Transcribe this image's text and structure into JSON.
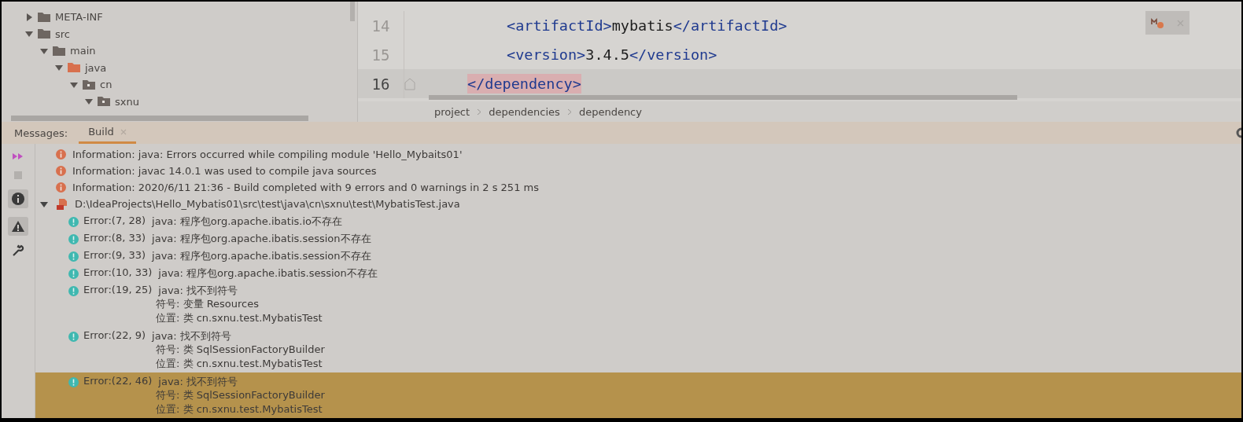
{
  "project_tree": {
    "items": [
      {
        "label": "META-INF",
        "expanded": false,
        "kind": "plain"
      },
      {
        "label": "src",
        "expanded": true,
        "kind": "plain",
        "children": [
          {
            "label": "main",
            "expanded": true,
            "kind": "plain",
            "children": [
              {
                "label": "java",
                "expanded": true,
                "kind": "source",
                "children": [
                  {
                    "label": "cn",
                    "expanded": true,
                    "kind": "package",
                    "children": [
                      {
                        "label": "sxnu",
                        "expanded": true,
                        "kind": "package"
                      }
                    ]
                  }
                ]
              }
            ]
          }
        ]
      }
    ]
  },
  "editor": {
    "lines": [
      {
        "number": "14",
        "kind": "nested",
        "current": false,
        "tokens": [
          {
            "kind": "tag",
            "text": "<artifactId>",
            "highlighted": false
          },
          {
            "kind": "text",
            "text": "mybatis",
            "highlighted": false
          },
          {
            "kind": "tag",
            "text": "</artifactId>",
            "highlighted": false
          }
        ]
      },
      {
        "number": "15",
        "kind": "nested",
        "current": false,
        "tokens": [
          {
            "kind": "tag",
            "text": "<version>",
            "highlighted": false
          },
          {
            "kind": "text",
            "text": "3.4.5",
            "highlighted": false
          },
          {
            "kind": "tag",
            "text": "</version>",
            "highlighted": false
          }
        ]
      },
      {
        "number": "16",
        "kind": "outer",
        "current": true,
        "tokens": [
          {
            "kind": "tag",
            "text": "</dependency>",
            "highlighted": true
          }
        ]
      }
    ],
    "breadcrumbs": [
      "project",
      "dependencies",
      "dependency"
    ]
  },
  "messages": {
    "label": "Messages:",
    "tabs": [
      {
        "label": "Build",
        "selected": true
      }
    ],
    "rows": [
      {
        "kind": "info",
        "lines": [
          "Information: java: Errors occurred while compiling module 'Hello_Mybaits01'"
        ],
        "selected": false
      },
      {
        "kind": "info",
        "lines": [
          "Information: javac 14.0.1 was used to compile java sources"
        ],
        "selected": false
      },
      {
        "kind": "info",
        "lines": [
          "Information: 2020/6/11 21:36 - Build completed with 9 errors and 0 warnings in 2 s 251 ms"
        ],
        "selected": false
      },
      {
        "kind": "file",
        "lines": [
          "D:\\IdeaProjects\\Hello_Mybatis01\\src\\test\\java\\cn\\sxnu\\test\\MybatisTest.java"
        ],
        "selected": false,
        "expanded": true,
        "children": [
          {
            "kind": "error",
            "location": "Error:(7, 28)",
            "lines": [
              "java: 程序包org.apache.ibatis.io不存在"
            ],
            "selected": false
          },
          {
            "kind": "error",
            "location": "Error:(8, 33)",
            "lines": [
              "java: 程序包org.apache.ibatis.session不存在"
            ],
            "selected": false
          },
          {
            "kind": "error",
            "location": "Error:(9, 33)",
            "lines": [
              "java: 程序包org.apache.ibatis.session不存在"
            ],
            "selected": false
          },
          {
            "kind": "error",
            "location": "Error:(10, 33)",
            "lines": [
              "java: 程序包org.apache.ibatis.session不存在"
            ],
            "selected": false
          },
          {
            "kind": "error",
            "location": "Error:(19, 25)",
            "lines": [
              "java: 找不到符号",
              "符号:   变量 Resources",
              "位置: 类 cn.sxnu.test.MybatisTest"
            ],
            "selected": false
          },
          {
            "kind": "error",
            "location": "Error:(22, 9)",
            "lines": [
              "java: 找不到符号",
              "符号:   类 SqlSessionFactoryBuilder",
              "位置: 类 cn.sxnu.test.MybatisTest"
            ],
            "selected": false
          },
          {
            "kind": "error",
            "location": "Error:(22, 46)",
            "lines": [
              "java: 找不到符号",
              "符号:   类 SqlSessionFactoryBuilder",
              "位置: 类 cn.sxnu.test.MybatisTest"
            ],
            "selected": true
          }
        ]
      }
    ]
  }
}
